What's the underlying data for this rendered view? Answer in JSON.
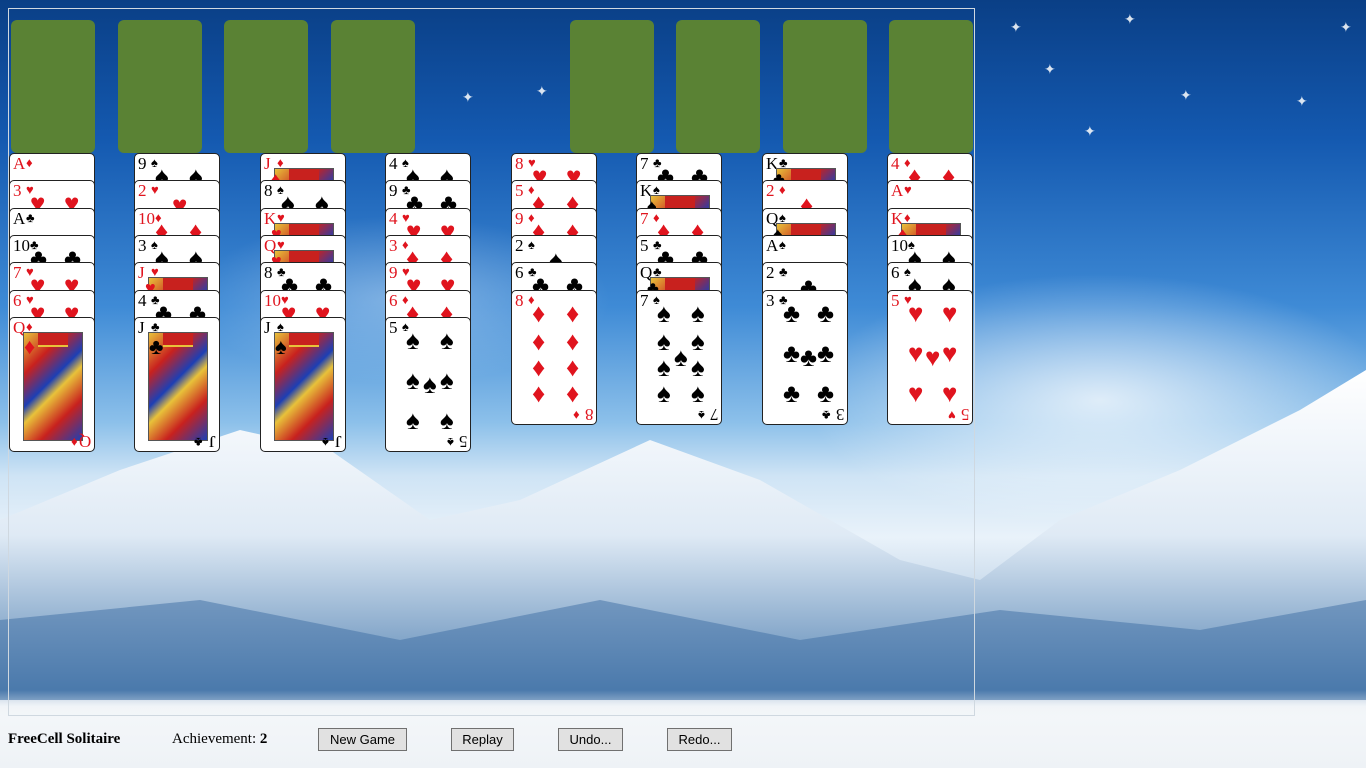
{
  "app": {
    "title": "FreeCell Solitaire"
  },
  "status": {
    "achievement_label": "Achievement:",
    "achievement_value": "2"
  },
  "buttons": {
    "new_game": "New Game",
    "replay": "Replay",
    "undo": "Undo...",
    "redo": "Redo..."
  },
  "colors": {
    "slot": "#5a8234",
    "red_suit": "#e0141e",
    "black_suit": "#000000"
  },
  "free_cells": [
    {
      "card": null
    },
    {
      "card": null
    },
    {
      "card": null
    },
    {
      "card": null
    }
  ],
  "foundations": [
    {
      "card": null
    },
    {
      "card": null
    },
    {
      "card": null
    },
    {
      "card": null
    }
  ],
  "tableau": [
    {
      "cards": [
        {
          "rank": "A",
          "suit": "♦"
        },
        {
          "rank": "3",
          "suit": "♥"
        },
        {
          "rank": "A",
          "suit": "♣"
        },
        {
          "rank": "10",
          "suit": "♣"
        },
        {
          "rank": "7",
          "suit": "♥"
        },
        {
          "rank": "6",
          "suit": "♥"
        },
        {
          "rank": "Q",
          "suit": "♦"
        }
      ]
    },
    {
      "cards": [
        {
          "rank": "9",
          "suit": "♠"
        },
        {
          "rank": "2",
          "suit": "♥"
        },
        {
          "rank": "10",
          "suit": "♦"
        },
        {
          "rank": "3",
          "suit": "♠"
        },
        {
          "rank": "J",
          "suit": "♥"
        },
        {
          "rank": "4",
          "suit": "♣"
        },
        {
          "rank": "J",
          "suit": "♣"
        }
      ]
    },
    {
      "cards": [
        {
          "rank": "J",
          "suit": "♦"
        },
        {
          "rank": "8",
          "suit": "♠"
        },
        {
          "rank": "K",
          "suit": "♥"
        },
        {
          "rank": "Q",
          "suit": "♥"
        },
        {
          "rank": "8",
          "suit": "♣"
        },
        {
          "rank": "10",
          "suit": "♥"
        },
        {
          "rank": "J",
          "suit": "♠"
        }
      ]
    },
    {
      "cards": [
        {
          "rank": "4",
          "suit": "♠"
        },
        {
          "rank": "9",
          "suit": "♣"
        },
        {
          "rank": "4",
          "suit": "♥"
        },
        {
          "rank": "3",
          "suit": "♦"
        },
        {
          "rank": "9",
          "suit": "♥"
        },
        {
          "rank": "6",
          "suit": "♦"
        },
        {
          "rank": "5",
          "suit": "♠"
        }
      ]
    },
    {
      "cards": [
        {
          "rank": "8",
          "suit": "♥"
        },
        {
          "rank": "5",
          "suit": "♦"
        },
        {
          "rank": "9",
          "suit": "♦"
        },
        {
          "rank": "2",
          "suit": "♠"
        },
        {
          "rank": "6",
          "suit": "♣"
        },
        {
          "rank": "8",
          "suit": "♦"
        }
      ]
    },
    {
      "cards": [
        {
          "rank": "7",
          "suit": "♣"
        },
        {
          "rank": "K",
          "suit": "♠"
        },
        {
          "rank": "7",
          "suit": "♦"
        },
        {
          "rank": "5",
          "suit": "♣"
        },
        {
          "rank": "Q",
          "suit": "♣"
        },
        {
          "rank": "7",
          "suit": "♠"
        }
      ]
    },
    {
      "cards": [
        {
          "rank": "K",
          "suit": "♣"
        },
        {
          "rank": "2",
          "suit": "♦"
        },
        {
          "rank": "Q",
          "suit": "♠"
        },
        {
          "rank": "A",
          "suit": "♠"
        },
        {
          "rank": "2",
          "suit": "♣"
        },
        {
          "rank": "3",
          "suit": "♣"
        }
      ]
    },
    {
      "cards": [
        {
          "rank": "4",
          "suit": "♦"
        },
        {
          "rank": "A",
          "suit": "♥"
        },
        {
          "rank": "K",
          "suit": "♦"
        },
        {
          "rank": "10",
          "suit": "♠"
        },
        {
          "rank": "6",
          "suit": "♠"
        },
        {
          "rank": "5",
          "suit": "♥"
        }
      ]
    }
  ]
}
